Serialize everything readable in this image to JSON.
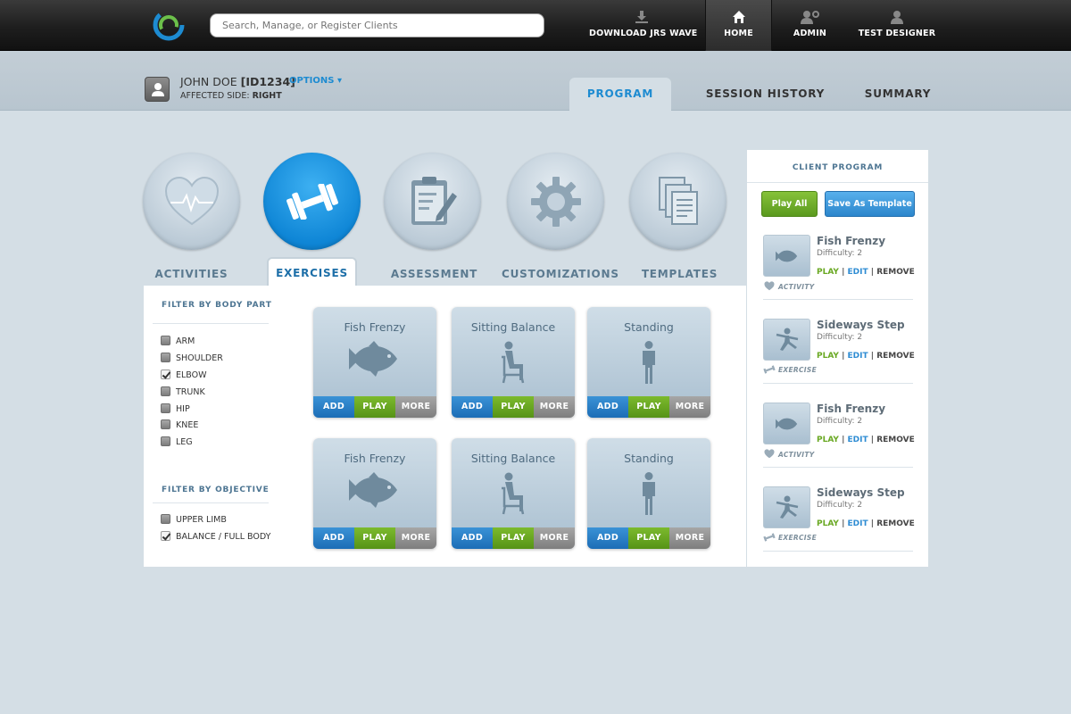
{
  "topbar": {
    "search_placeholder": "Search, Manage, or Register Clients",
    "nav": [
      {
        "label": "DOWNLOAD JRS WAVE",
        "icon": "download-icon"
      },
      {
        "label": "HOME",
        "icon": "home-icon",
        "active": true
      },
      {
        "label": "ADMIN",
        "icon": "admin-icon"
      },
      {
        "label": "TEST DESIGNER",
        "icon": "user-icon"
      }
    ]
  },
  "client": {
    "name": "JOHN DOE",
    "id": "[ID1234]",
    "options_label": "OPTIONS",
    "affected_label": "AFFECTED SIDE:",
    "affected_value": "RIGHT"
  },
  "program_tabs": [
    {
      "label": "PROGRAM",
      "active": true
    },
    {
      "label": "SESSION HISTORY"
    },
    {
      "label": "SUMMARY"
    }
  ],
  "categories": [
    {
      "label": "ACTIVITIES",
      "icon": "heart-icon"
    },
    {
      "label": "EXERCISES",
      "icon": "dumbbell-icon",
      "active": true
    },
    {
      "label": "ASSESSMENT",
      "icon": "clipboard-icon"
    },
    {
      "label": "CUSTOMIZATIONS",
      "icon": "gear-icon"
    },
    {
      "label": "TEMPLATES",
      "icon": "documents-icon"
    }
  ],
  "filters": {
    "body_part_title": "FILTER BY BODY PART",
    "body_parts": [
      {
        "label": "ARM",
        "checked": false
      },
      {
        "label": "SHOULDER",
        "checked": false
      },
      {
        "label": "ELBOW",
        "checked": true
      },
      {
        "label": "TRUNK",
        "checked": false
      },
      {
        "label": "HIP",
        "checked": false
      },
      {
        "label": "KNEE",
        "checked": false
      },
      {
        "label": "LEG",
        "checked": false
      }
    ],
    "objective_title": "FILTER BY OBJECTIVE",
    "objectives": [
      {
        "label": "UPPER LIMB",
        "checked": false
      },
      {
        "label": "BALANCE / FULL BODY",
        "checked": true
      }
    ]
  },
  "cards": [
    {
      "title": "Fish Frenzy",
      "icon": "fish-icon"
    },
    {
      "title": "Sitting Balance",
      "icon": "sitting-person-icon"
    },
    {
      "title": "Standing",
      "icon": "standing-person-icon"
    },
    {
      "title": "Fish Frenzy",
      "icon": "fish-icon"
    },
    {
      "title": "Sitting Balance",
      "icon": "sitting-person-icon"
    },
    {
      "title": "Standing",
      "icon": "standing-person-icon"
    }
  ],
  "card_buttons": {
    "add": "ADD",
    "play": "PLAY",
    "more": "MORE"
  },
  "client_program": {
    "title": "CLIENT PROGRAM",
    "play_all": "Play All",
    "save_template": "Save As Template",
    "actions": {
      "play": "PLAY",
      "edit": "EDIT",
      "remove": "REMOVE"
    },
    "items": [
      {
        "name": "Fish Frenzy",
        "difficulty": "Difficulty: 2",
        "type": "ACTIVITY",
        "icon": "fish-icon"
      },
      {
        "name": "Sideways Step",
        "difficulty": "Difficulty: 2",
        "type": "EXERCISE",
        "icon": "lunge-person-icon"
      },
      {
        "name": "Fish Frenzy",
        "difficulty": "Difficulty: 2",
        "type": "ACTIVITY",
        "icon": "fish-icon"
      },
      {
        "name": "Sideways Step",
        "difficulty": "Difficulty: 2",
        "type": "EXERCISE",
        "icon": "lunge-person-icon"
      }
    ]
  },
  "colors": {
    "accent_blue": "#1d8bd1",
    "play_green": "#69a822",
    "page_bg": "#d4dee5"
  }
}
